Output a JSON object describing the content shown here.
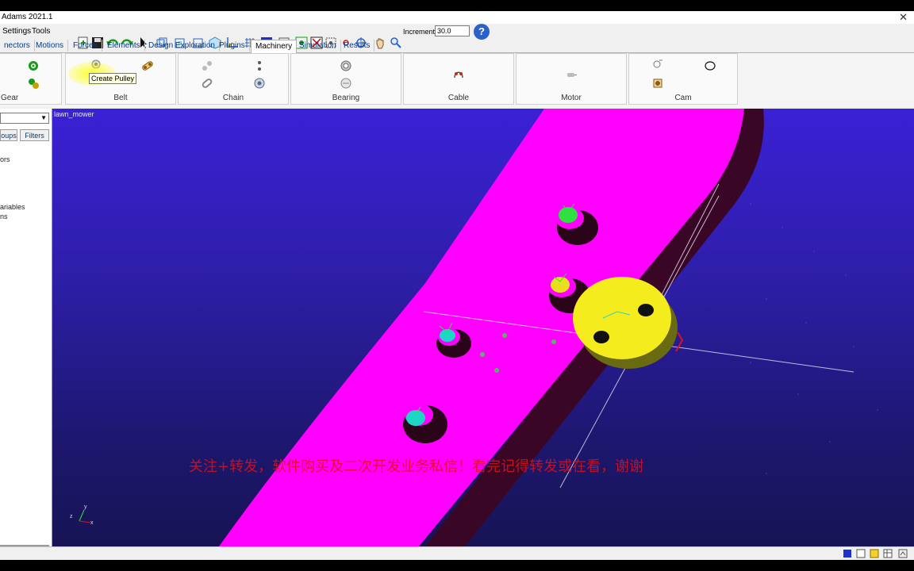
{
  "window": {
    "title": "Adams 2021.1",
    "close": "✕"
  },
  "menu": {
    "items": [
      "Settings",
      "Tools"
    ]
  },
  "toolbar": {
    "increment_label": "Increment",
    "increment_value": "30.0",
    "help_label": "?"
  },
  "tabs": [
    "nectors",
    "Motions",
    "Forces",
    "Elements",
    "Design Exploration",
    "Plugins",
    "Machinery",
    "Simulation",
    "Results"
  ],
  "active_tab": "Machinery",
  "ribbon": {
    "groups": [
      "Gear",
      "Belt",
      "Chain",
      "Bearing",
      "Cable",
      "Motor",
      "Cam"
    ],
    "tooltip": "Create Pulley"
  },
  "sidebar": {
    "tabs": [
      "oups",
      "Filters"
    ],
    "items": [
      "ors",
      "",
      "",
      "ariables",
      "ns"
    ]
  },
  "viewport": {
    "model_name": "lawn_mower",
    "watermark": "关注+转发，软件购买及二次开发业务私信！看完记得转发或在看，谢谢",
    "triad": {
      "x": "x",
      "y": "y",
      "z": "z"
    }
  },
  "colors": {
    "plate": "#ff00ff",
    "plate_side": "#3a0626",
    "pulley": "#f5ec1e",
    "marker_green": "#30e040",
    "marker_cyan": "#1ed6c8",
    "marker_yellow": "#e8e01e"
  }
}
